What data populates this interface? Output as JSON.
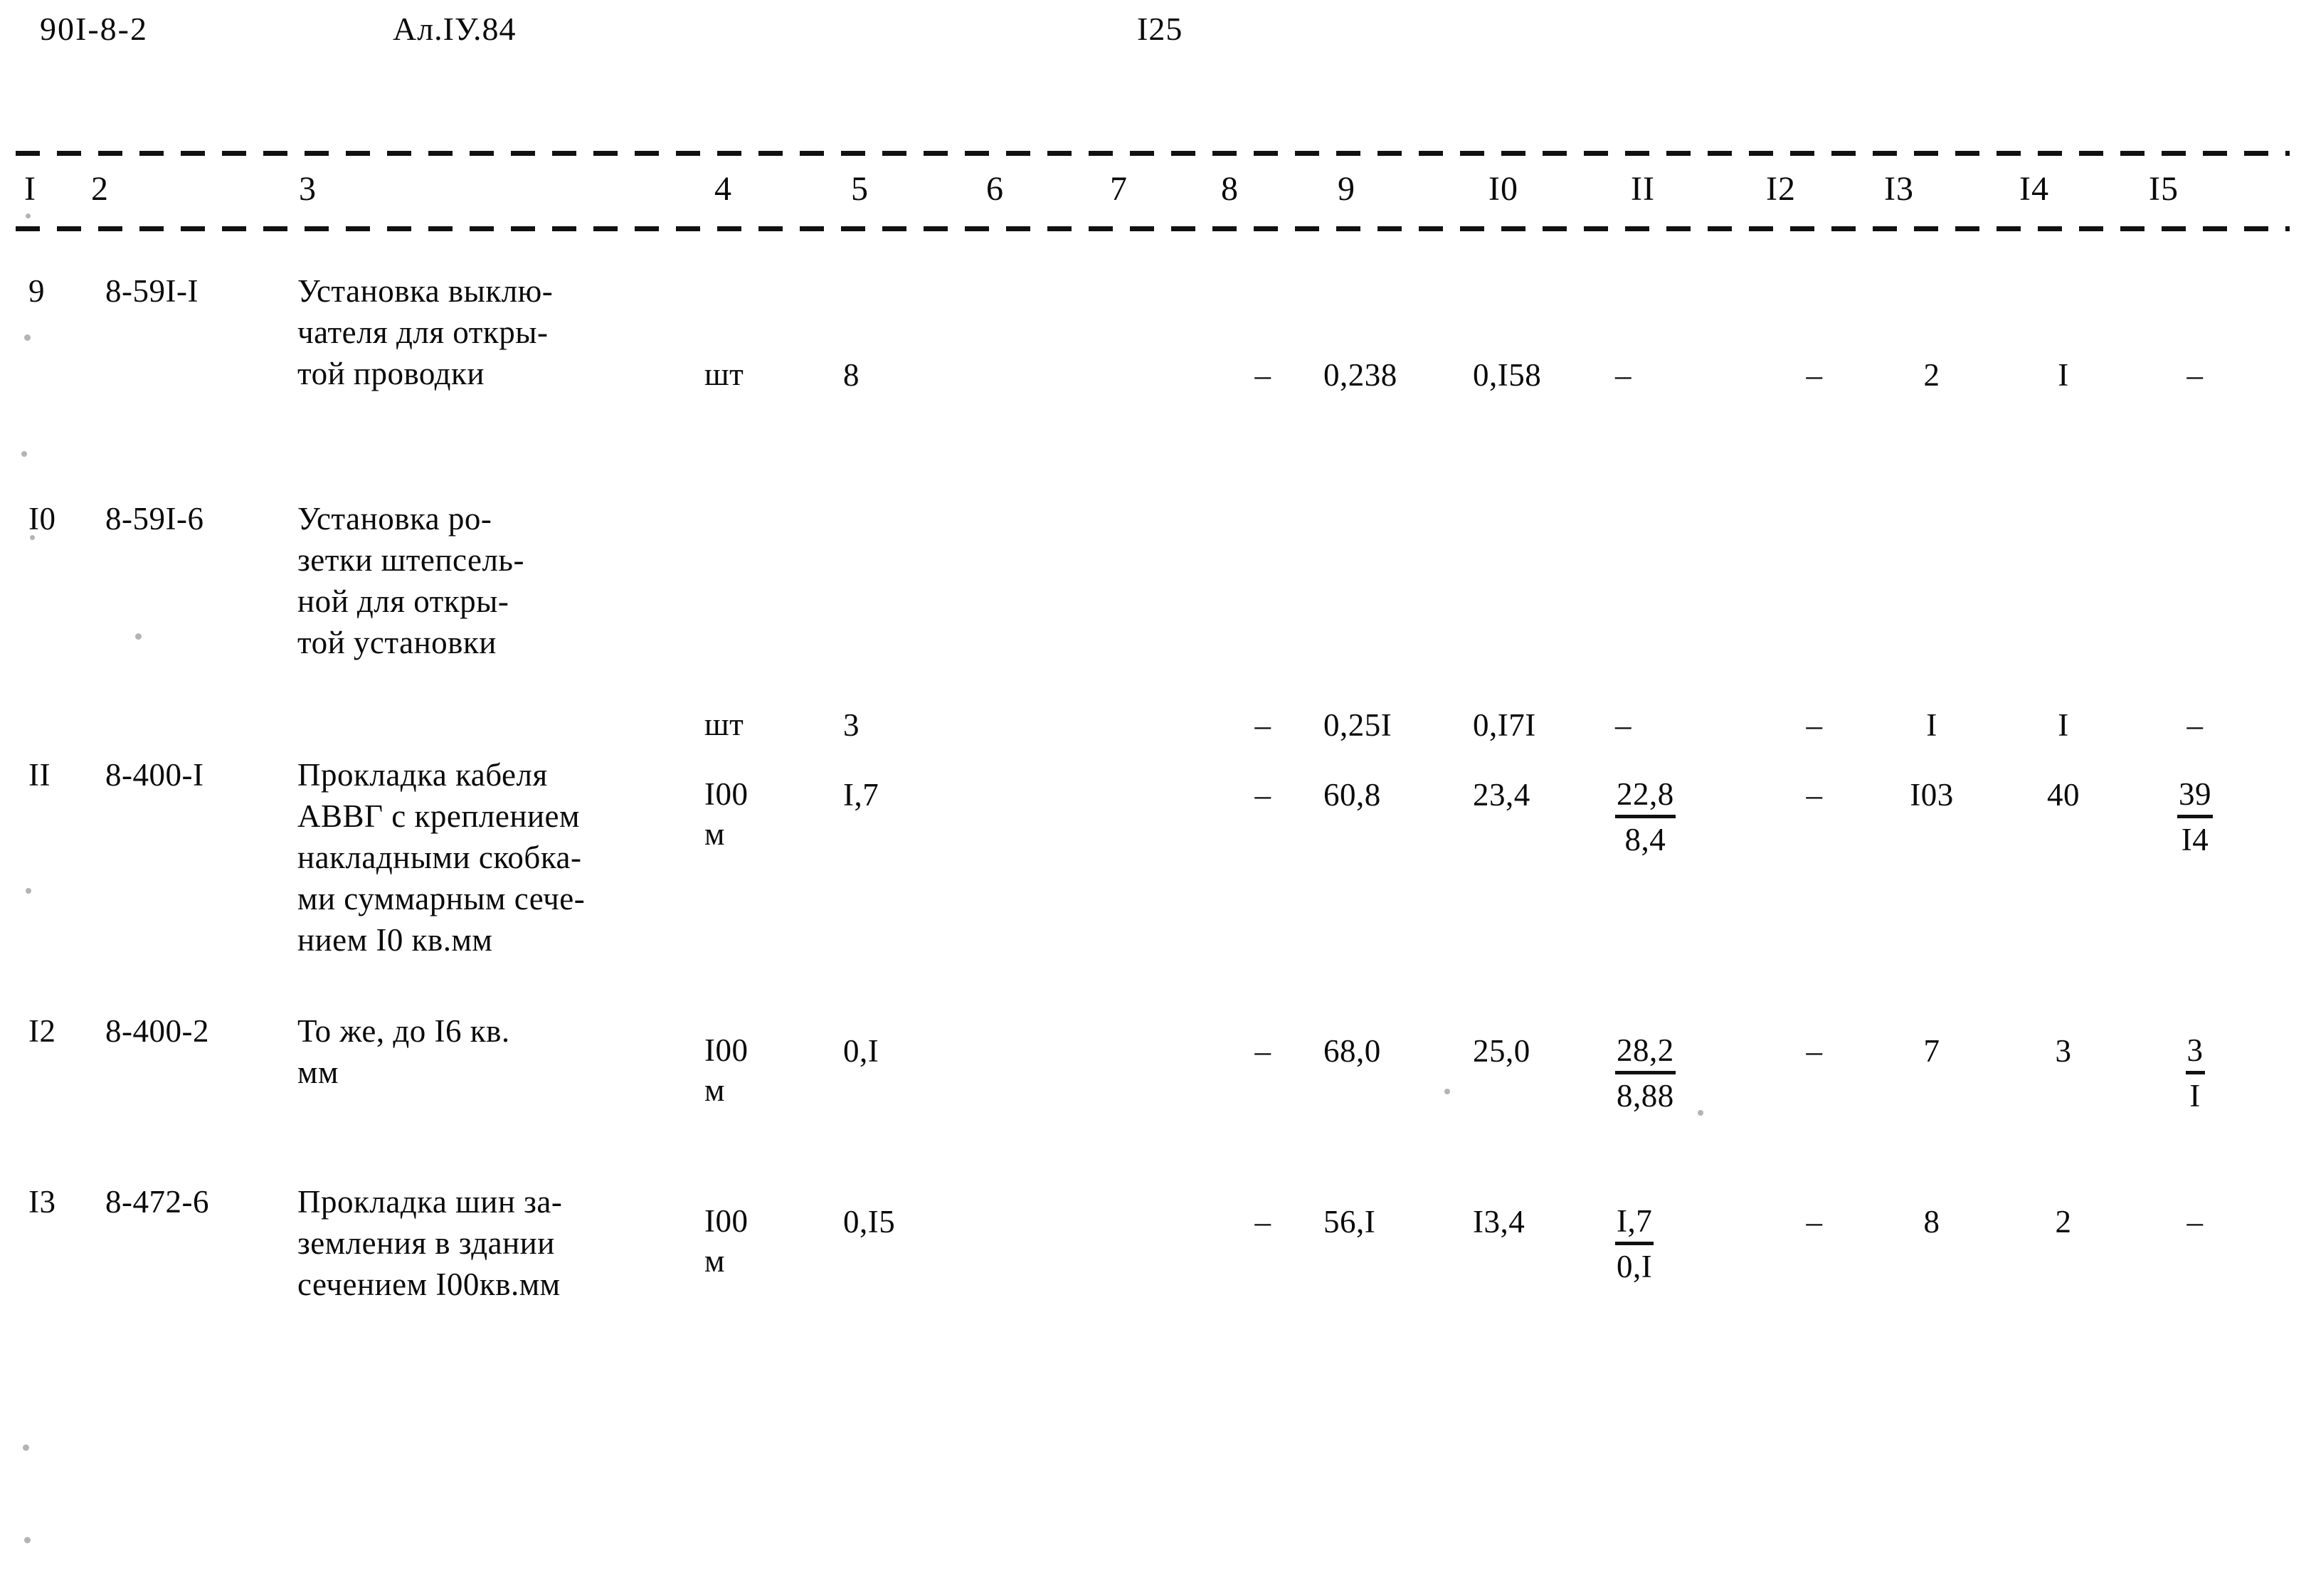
{
  "header": {
    "series_code": "90I-8-2",
    "album": "Ал.IУ.84",
    "page_number": "I25"
  },
  "table": {
    "column_headers": [
      "I",
      "2",
      "3",
      "4",
      "5",
      "6",
      "7",
      "8",
      "9",
      "I0",
      "II",
      "I2",
      "I3",
      "I4",
      "I5"
    ],
    "rows": [
      {
        "num": "9",
        "code": "8-59I-I",
        "description": "Установка выклю-\nчателя для откры-\nтой проводки",
        "unit": "шт",
        "qty": "8",
        "c6": "",
        "c7": "",
        "c8": "–",
        "c9": "0,238",
        "c10": "0,I58",
        "c11": "–",
        "c11_den": "",
        "c12": "–",
        "c13": "2",
        "c14": "I",
        "c15": "–",
        "c15_den": ""
      },
      {
        "num": "I0",
        "code": "8-59I-6",
        "description": "Установка ро-\nзетки штепсель-\nной для откры-\nтой установки",
        "unit": "шт",
        "qty": "3",
        "c6": "",
        "c7": "",
        "c8": "–",
        "c9": "0,25I",
        "c10": "0,I7I",
        "c11": "–",
        "c11_den": "",
        "c12": "–",
        "c13": "I",
        "c14": "I",
        "c15": "–",
        "c15_den": ""
      },
      {
        "num": "II",
        "code": "8-400-I",
        "description": "Прокладка кабеля\nАВВГ с креплением\nнакладными скобка-\nми суммарным сече-\nнием I0 кв.мм",
        "unit": "I00\nм",
        "qty": "I,7",
        "c6": "",
        "c7": "",
        "c8": "–",
        "c9": "60,8",
        "c10": "23,4",
        "c11": "22,8",
        "c11_den": "8,4",
        "c12": "–",
        "c13": "I03",
        "c14": "40",
        "c15": "39",
        "c15_den": "I4"
      },
      {
        "num": "I2",
        "code": "8-400-2",
        "description": "То же, до I6 кв.\nмм",
        "unit": "I00\nм",
        "qty": "0,I",
        "c6": "",
        "c7": "",
        "c8": "–",
        "c9": "68,0",
        "c10": "25,0",
        "c11": "28,2",
        "c11_den": "8,88",
        "c12": "–",
        "c13": "7",
        "c14": "3",
        "c15": "3",
        "c15_den": "I"
      },
      {
        "num": "I3",
        "code": "8-472-6",
        "description": "Прокладка шин за-\nземления в здании\nсечением I00кв.мм",
        "unit": "I00\nм",
        "qty": "0,I5",
        "c6": "",
        "c7": "",
        "c8": "–",
        "c9": "56,I",
        "c10": "I3,4",
        "c11": "I,7",
        "c11_den": "0,I",
        "c12": "–",
        "c13": "8",
        "c14": "2",
        "c15": "–",
        "c15_den": ""
      }
    ]
  }
}
